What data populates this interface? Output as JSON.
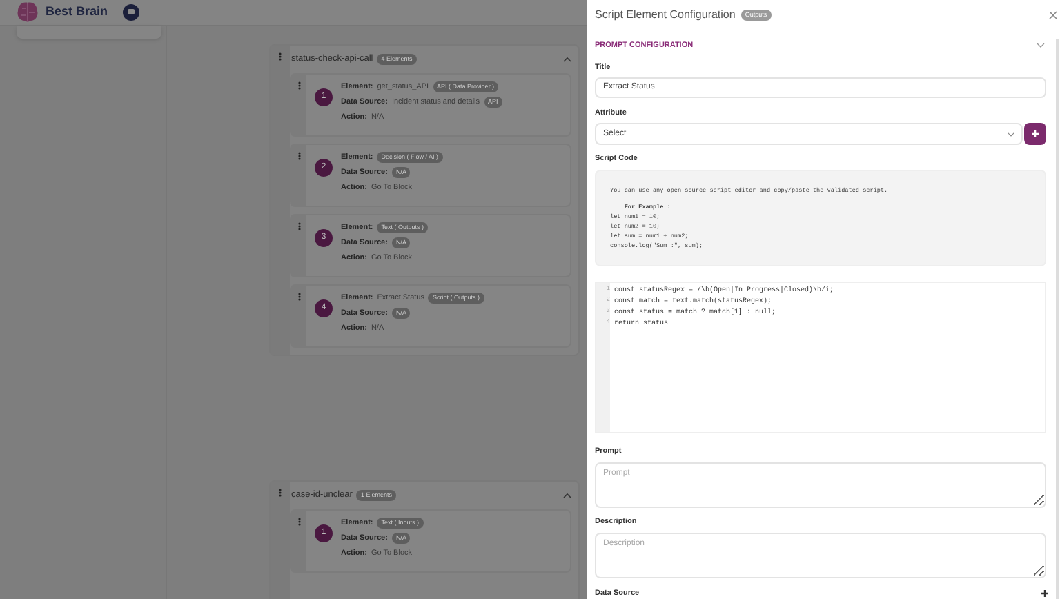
{
  "app": {
    "brand": "Best Brain"
  },
  "groups": [
    {
      "name": "status-check-api-call",
      "count": "4 Elements",
      "expanded": true,
      "items": [
        {
          "number": "1",
          "element_label": "Element:",
          "element": "get_status_API",
          "element_tag": "API ( Data Provider )",
          "source_label": "Data Source:",
          "source": "Incident status and details",
          "source_tag": "API",
          "action_label": "Action:",
          "action": "N/A"
        },
        {
          "number": "2",
          "element_label": "Element:",
          "element_tag": "Decision ( Flow / AI )",
          "source_label": "Data Source:",
          "source_tag": "N/A",
          "action_label": "Action:",
          "action": "Go To Block"
        },
        {
          "number": "3",
          "element_label": "Element:",
          "element_tag": "Text ( Outputs )",
          "source_label": "Data Source:",
          "source_tag": "N/A",
          "action_label": "Action:",
          "action": "Go To Block"
        },
        {
          "number": "4",
          "element_label": "Element:",
          "element": "Extract Status",
          "element_tag": "Script ( Outputs )",
          "source_label": "Data Source:",
          "source_tag": "N/A",
          "action_label": "Action:",
          "action": "N/A"
        }
      ]
    },
    {
      "name": "case-id-unclear",
      "count": "1 Elements",
      "expanded": true,
      "items": [
        {
          "number": "1",
          "element_label": "Element:",
          "element_tag": "Text ( Inputs )",
          "source_label": "Data Source:",
          "source_tag": "N/A",
          "action_label": "Action:",
          "action": "Go To Block"
        }
      ]
    }
  ],
  "panel": {
    "title": "Script Element Configuration",
    "badge": "Outputs",
    "section": "PROMPT CONFIGURATION",
    "section_expanded": true,
    "title_label": "Title",
    "title_value": "Extract Status",
    "attribute_label": "Attribute",
    "attribute_value": "Select",
    "script_label": "Script Code",
    "example_intro": "You can use any open source script editor and copy/paste the validated script.",
    "example_lines": [
      "    **For Example :**",
      "let num1 = 10;",
      "let num2 = 10;",
      "let sum = num1 + num2;",
      "console.log(\"Sum :\", sum);"
    ],
    "code_lines": [
      {
        "number": "1",
        "text": "const statusRegex = /\\b(Open|In Progress|Closed)\\b/i;"
      },
      {
        "number": "2",
        "text": "const match = text.match(statusRegex);"
      },
      {
        "number": "3",
        "text": "const status = match ? match[1] : null;"
      },
      {
        "number": "4",
        "text": "return status"
      }
    ],
    "prompt_label": "Prompt",
    "prompt_placeholder": "Prompt",
    "description_label": "Description",
    "description_placeholder": "Description",
    "data_source_label": "Data Source"
  }
}
